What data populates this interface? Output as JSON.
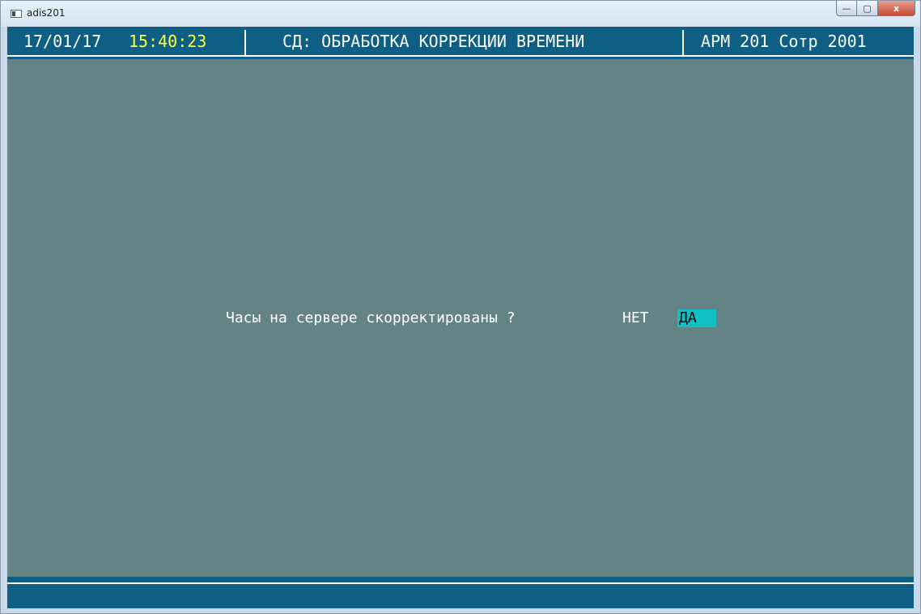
{
  "window": {
    "title": "adis201",
    "controls": {
      "minimize_glyph": "—",
      "maximize_glyph": "▢",
      "close_glyph": "x"
    }
  },
  "header": {
    "date": "17/01/17",
    "time": "15:40:23",
    "title": "СД: ОБРАБОТКА КОРРЕКЦИИ ВРЕМЕНИ",
    "workstation": "АРМ 201 Сотр 2001"
  },
  "dialog": {
    "question": "Часы на сервере скорректированы ?",
    "options": {
      "no": "НЕТ",
      "yes": "ДА"
    },
    "selected": "yes"
  },
  "colors": {
    "console_background": "#648385",
    "bar_background": "#0f5f84",
    "time_color": "#ffff3a",
    "selection_background": "#12c0c4"
  }
}
